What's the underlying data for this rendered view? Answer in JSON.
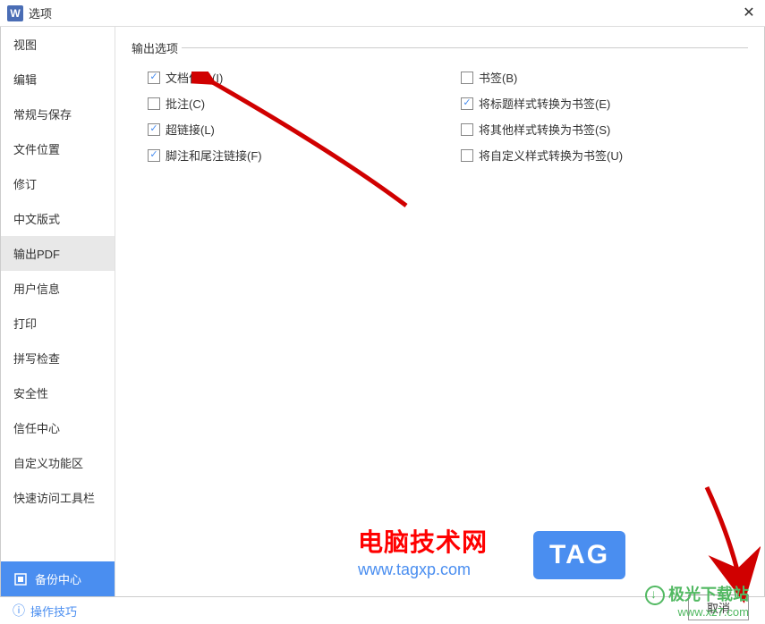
{
  "titlebar": {
    "title": "选项",
    "app_letter": "W"
  },
  "sidebar": {
    "items": [
      {
        "label": "视图"
      },
      {
        "label": "编辑"
      },
      {
        "label": "常规与保存"
      },
      {
        "label": "文件位置"
      },
      {
        "label": "修订"
      },
      {
        "label": "中文版式"
      },
      {
        "label": "输出PDF"
      },
      {
        "label": "用户信息"
      },
      {
        "label": "打印"
      },
      {
        "label": "拼写检查"
      },
      {
        "label": "安全性"
      },
      {
        "label": "信任中心"
      },
      {
        "label": "自定义功能区"
      },
      {
        "label": "快速访问工具栏"
      }
    ],
    "selected_index": 6,
    "backup_center": "备份中心"
  },
  "main": {
    "section_title": "输出选项",
    "left_options": [
      {
        "label": "文档信息(I)",
        "checked": true
      },
      {
        "label": "批注(C)",
        "checked": false
      },
      {
        "label": "超链接(L)",
        "checked": true
      },
      {
        "label": "脚注和尾注链接(F)",
        "checked": true
      }
    ],
    "right_options": [
      {
        "label": "书签(B)",
        "checked": false
      },
      {
        "label": "将标题样式转换为书签(E)",
        "checked": true
      },
      {
        "label": "将其他样式转换为书签(S)",
        "checked": false
      },
      {
        "label": "将自定义样式转换为书签(U)",
        "checked": false
      }
    ]
  },
  "footer": {
    "help_text": "操作技巧",
    "cancel_button": "取消"
  },
  "watermarks": {
    "wm1_line1": "电脑技术网",
    "wm1_line2": "www.tagxp.com",
    "tag": "TAG",
    "wm2_line1": "极光下载站",
    "wm2_line2": "www.xz7.com"
  }
}
